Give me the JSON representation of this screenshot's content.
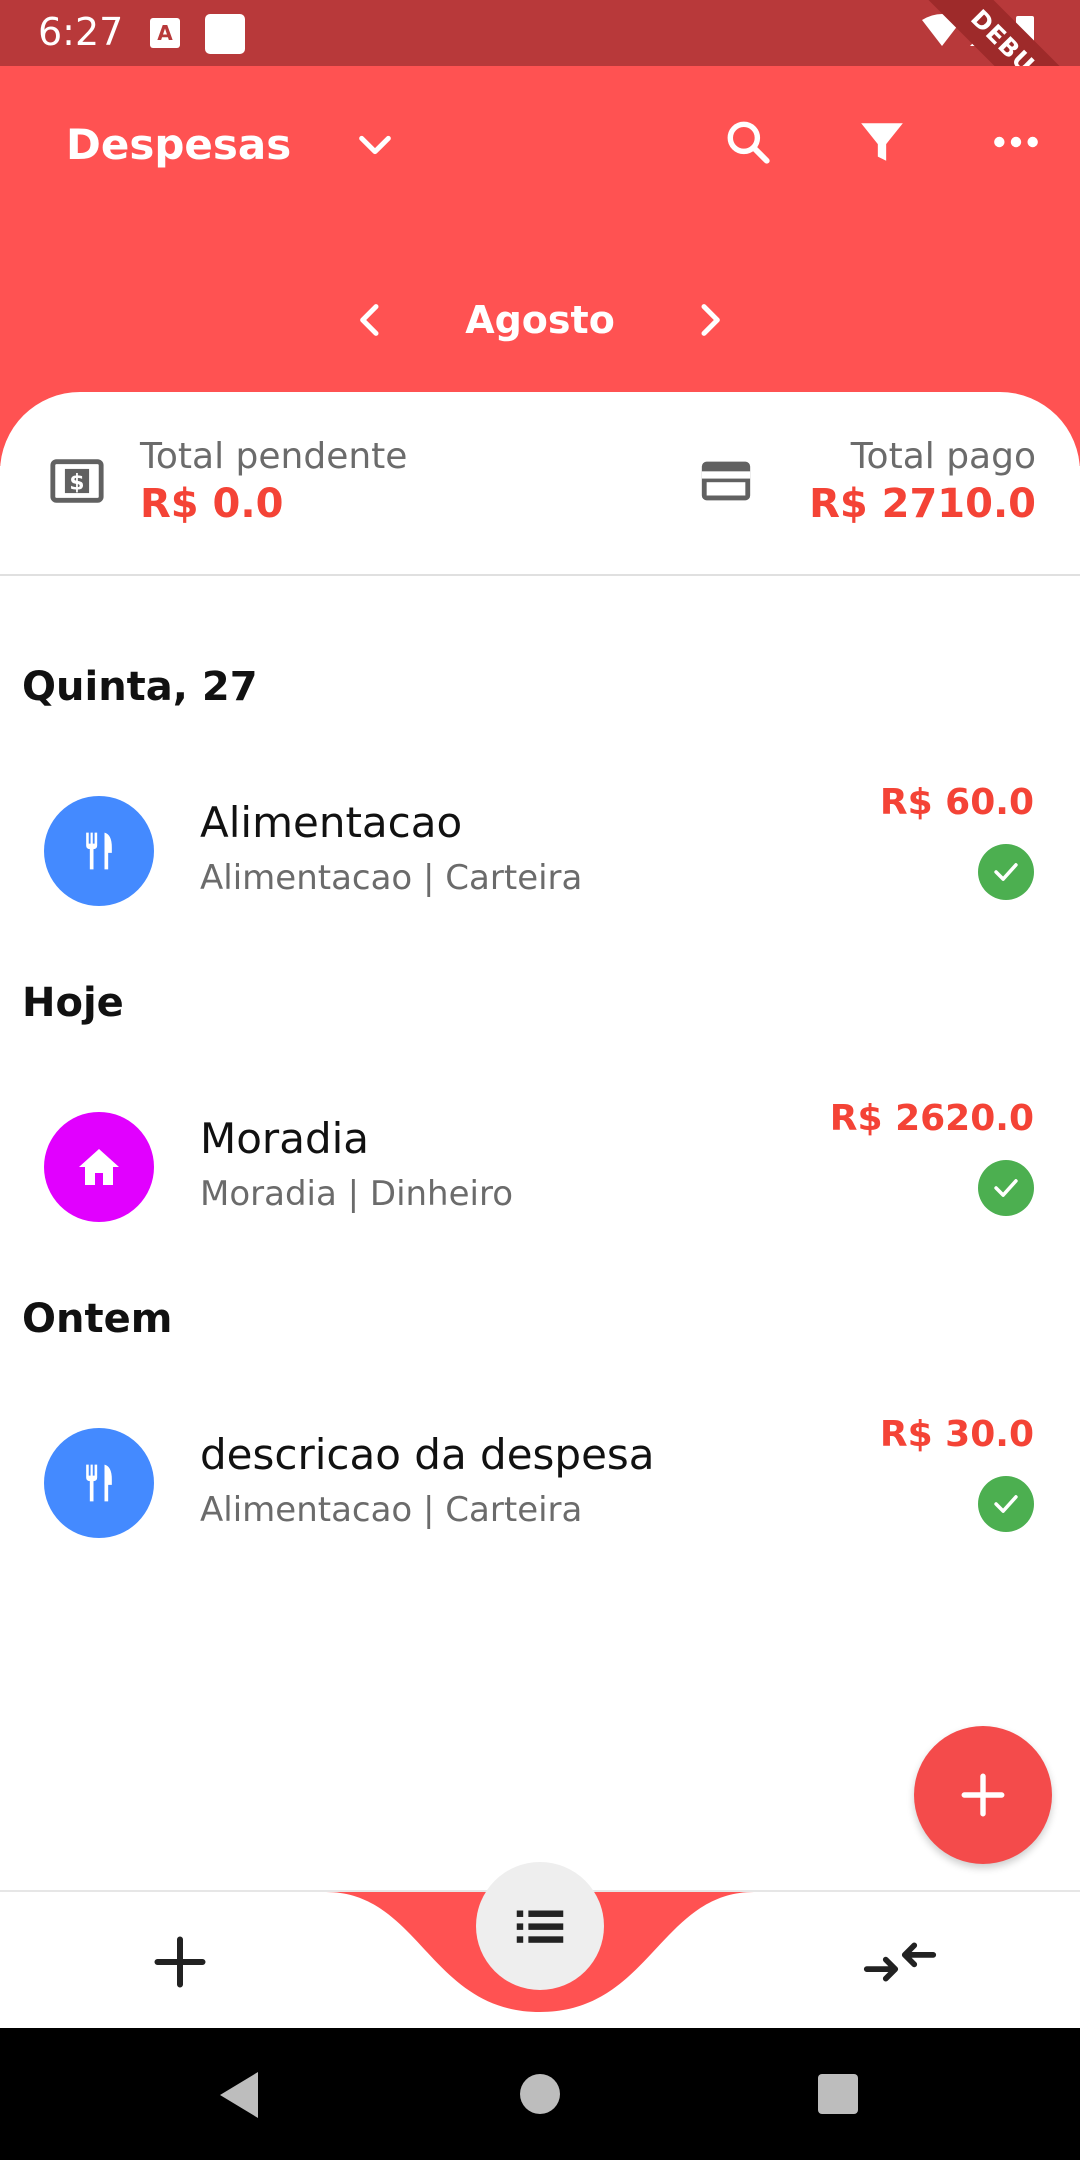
{
  "status_bar": {
    "time": "6:27",
    "notification_a": "A",
    "debug_label": "DEBUG"
  },
  "app_bar": {
    "title": "Despesas",
    "month": "Agosto",
    "accent_color": "#ff5252"
  },
  "summary": {
    "pending_label": "Total pendente",
    "pending_value": "R$ 0.0",
    "paid_label": "Total pago",
    "paid_value": "R$ 2710.0"
  },
  "groups": [
    {
      "header": "Quinta, 27",
      "items": [
        {
          "title": "Alimentacao",
          "subtitle": "Alimentacao | Carteira",
          "amount": "R$ 60.0",
          "icon": "restaurant-icon",
          "color": "#448aff",
          "paid": true
        }
      ]
    },
    {
      "header": "Hoje",
      "items": [
        {
          "title": "Moradia",
          "subtitle": "Moradia | Dinheiro",
          "amount": "R$ 2620.0",
          "icon": "home-icon",
          "color": "#e100ff",
          "paid": true
        }
      ]
    },
    {
      "header": "Ontem",
      "items": [
        {
          "title": "descricao da despesa",
          "subtitle": "Alimentacao | Carteira",
          "amount": "R$ 30.0",
          "icon": "restaurant-icon",
          "color": "#448aff",
          "paid": true
        }
      ]
    }
  ],
  "colors": {
    "paid_check": "#4caf50",
    "amount": "#f44336"
  }
}
